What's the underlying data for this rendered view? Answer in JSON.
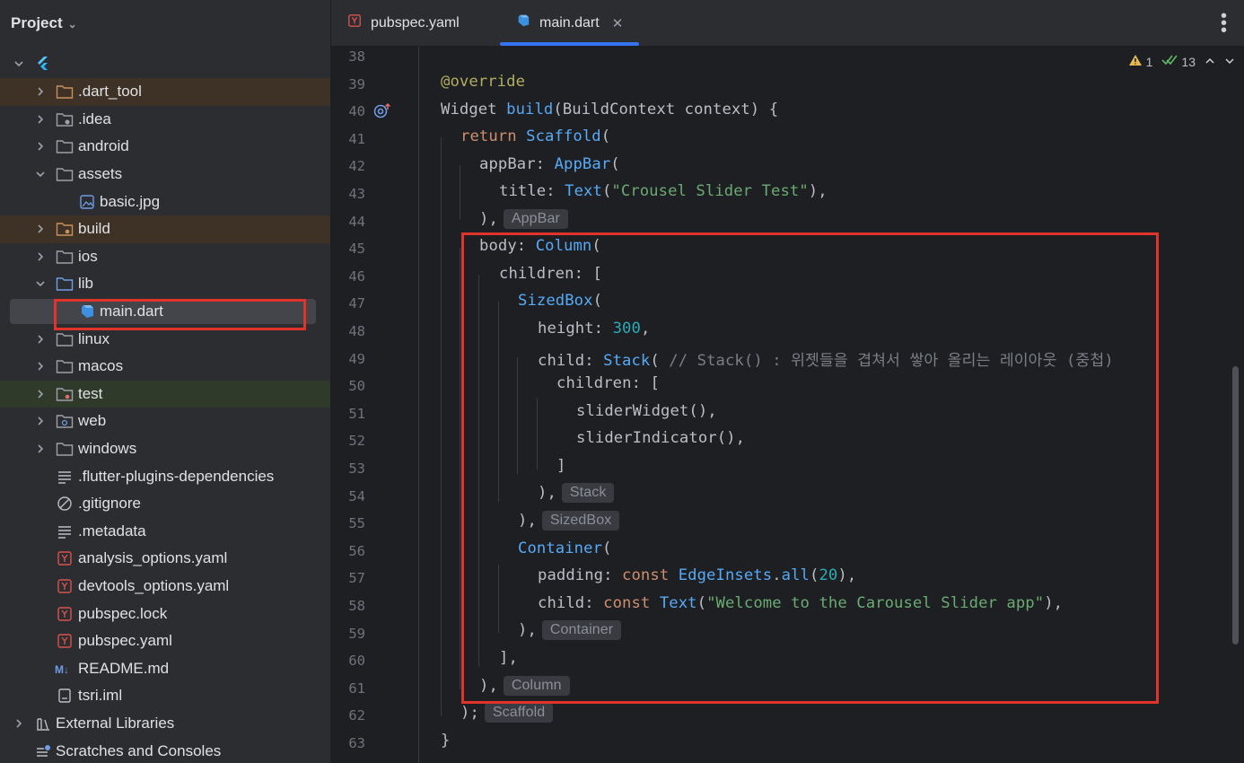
{
  "sidebar": {
    "title": "Project",
    "items": [
      {
        "label": ".dart_tool"
      },
      {
        "label": ".idea"
      },
      {
        "label": "android"
      },
      {
        "label": "assets"
      },
      {
        "label": "basic.jpg"
      },
      {
        "label": "build"
      },
      {
        "label": "ios"
      },
      {
        "label": "lib"
      },
      {
        "label": "main.dart"
      },
      {
        "label": "linux"
      },
      {
        "label": "macos"
      },
      {
        "label": "test"
      },
      {
        "label": "web"
      },
      {
        "label": "windows"
      },
      {
        "label": ".flutter-plugins-dependencies"
      },
      {
        "label": ".gitignore"
      },
      {
        "label": ".metadata"
      },
      {
        "label": "analysis_options.yaml"
      },
      {
        "label": "devtools_options.yaml"
      },
      {
        "label": "pubspec.lock"
      },
      {
        "label": "pubspec.yaml"
      },
      {
        "label": "README.md"
      },
      {
        "label": "tsri.iml"
      },
      {
        "label": "External Libraries"
      },
      {
        "label": "Scratches and Consoles"
      }
    ]
  },
  "tabs": [
    {
      "label": "pubspec.yaml"
    },
    {
      "label": "main.dart"
    }
  ],
  "status": {
    "warnings": "1",
    "checks": "13"
  },
  "editor": {
    "line_numbers": [
      "38",
      "39",
      "40",
      "41",
      "42",
      "43",
      "44",
      "45",
      "46",
      "47",
      "48",
      "49",
      "50",
      "51",
      "52",
      "53",
      "54",
      "55",
      "56",
      "57",
      "58",
      "59",
      "60",
      "61",
      "62",
      "63"
    ],
    "code": {
      "l39": "@override",
      "l40_a": "Widget ",
      "l40_b": "build",
      "l40_c": "(BuildContext context) {",
      "l41_a": "return ",
      "l41_b": "Scaffold",
      "l41_c": "(",
      "l42_a": "appBar: ",
      "l42_b": "AppBar",
      "l42_c": "(",
      "l43_a": "title: ",
      "l43_b": "Text",
      "l43_c": "(",
      "l43_d": "\"Crousel Slider Test\"",
      "l43_e": "),",
      "l44": "),",
      "l44_hint": "AppBar",
      "l45_a": "body: ",
      "l45_b": "Column",
      "l45_c": "(",
      "l46": "children: [",
      "l47_a": "SizedBox",
      "l47_b": "(",
      "l48_a": "height: ",
      "l48_b": "300",
      "l48_c": ",",
      "l49_a": "child: ",
      "l49_b": "Stack",
      "l49_c": "( ",
      "l49_d": "// Stack() : 위젯들을 겹쳐서 쌓아 올리는 레이아웃 (중첩)",
      "l50": "children: [",
      "l51": "sliderWidget(),",
      "l52": "sliderIndicator(),",
      "l53": "]",
      "l54": "),",
      "l54_hint": "Stack",
      "l55": "),",
      "l55_hint": "SizedBox",
      "l56_a": "Container",
      "l56_b": "(",
      "l57_a": "padding: ",
      "l57_b": "const ",
      "l57_c": "EdgeInsets",
      "l57_d": ".",
      "l57_e": "all",
      "l57_f": "(",
      "l57_g": "20",
      "l57_h": "),",
      "l58_a": "child: ",
      "l58_b": "const ",
      "l58_c": "Text",
      "l58_d": "(",
      "l58_e": "\"Welcome to the Carousel Slider app\"",
      "l58_f": "),",
      "l59": "),",
      "l59_hint": "Container",
      "l60": "],",
      "l61": "),",
      "l61_hint": "Column",
      "l62": ");",
      "l62_hint": "Scaffold",
      "l63": "}"
    }
  },
  "colors": {
    "highlight_box": "#e0332a",
    "tab_accent": "#3574f0"
  }
}
